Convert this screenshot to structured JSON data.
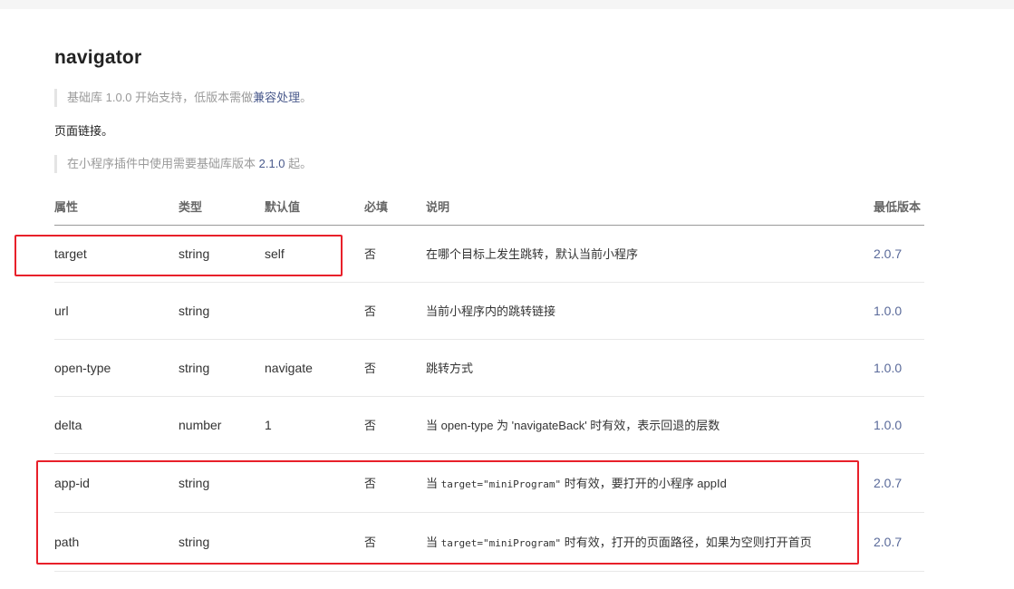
{
  "title": "navigator",
  "notice_support": {
    "prefix": "基础库 1.0.0 开始支持，低版本需做",
    "link": "兼容处理",
    "suffix": "。"
  },
  "description": "页面链接。",
  "notice_plugin": {
    "prefix": "在小程序插件中使用需要基础库版本 ",
    "version": "2.1.0",
    "suffix": " 起。"
  },
  "table": {
    "headers": {
      "attr": "属性",
      "type": "类型",
      "default": "默认值",
      "required": "必填",
      "desc": "说明",
      "min_version": "最低版本"
    },
    "rows": [
      {
        "attr": "target",
        "type": "string",
        "default": "self",
        "required": "否",
        "desc": "在哪个目标上发生跳转，默认当前小程序",
        "min_version": "2.0.7"
      },
      {
        "attr": "url",
        "type": "string",
        "default": "",
        "required": "否",
        "desc": "当前小程序内的跳转链接",
        "min_version": "1.0.0"
      },
      {
        "attr": "open-type",
        "type": "string",
        "default": "navigate",
        "required": "否",
        "desc": "跳转方式",
        "min_version": "1.0.0"
      },
      {
        "attr": "delta",
        "type": "number",
        "default": "1",
        "required": "否",
        "desc": "当 open-type 为 'navigateBack' 时有效，表示回退的层数",
        "min_version": "1.0.0"
      },
      {
        "attr": "app-id",
        "type": "string",
        "default": "",
        "required": "否",
        "desc_prefix": "当 ",
        "desc_code": "target=\"miniProgram\"",
        "desc_suffix": " 时有效，要打开的小程序 appId",
        "min_version": "2.0.7"
      },
      {
        "attr": "path",
        "type": "string",
        "default": "",
        "required": "否",
        "desc_prefix": "当 ",
        "desc_code": "target=\"miniProgram\"",
        "desc_suffix": " 时有效，打开的页面路径，如果为空则打开首页",
        "min_version": "2.0.7"
      }
    ]
  },
  "colors": {
    "highlight": "#e8202a",
    "link": "#4a5a8c"
  }
}
